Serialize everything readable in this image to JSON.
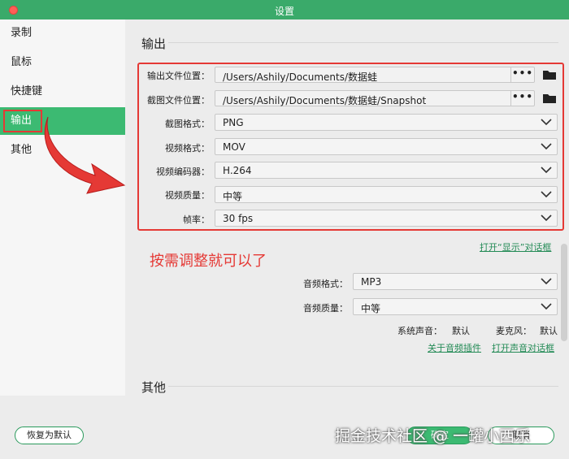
{
  "window": {
    "title": "设置"
  },
  "sidebar": {
    "items": [
      {
        "label": "录制"
      },
      {
        "label": "鼠标"
      },
      {
        "label": "快捷键"
      },
      {
        "label": "输出"
      },
      {
        "label": "其他"
      }
    ],
    "active_index": 3
  },
  "output": {
    "section_title": "输出",
    "output_location": {
      "label": "输出文件位置：",
      "value": "/Users/Ashily/Documents/数据蛙",
      "browse": "•••"
    },
    "screenshot_location": {
      "label": "截图文件位置：",
      "value": "/Users/Ashily/Documents/数据蛙/Snapshot",
      "browse": "•••"
    },
    "screenshot_format": {
      "label": "截图格式：",
      "value": "PNG"
    },
    "video_format": {
      "label": "视频格式：",
      "value": "MOV"
    },
    "video_encoder": {
      "label": "视频编码器：",
      "value": "H.264"
    },
    "video_quality": {
      "label": "视频质量：",
      "value": "中等"
    },
    "frame_rate": {
      "label": "帧率：",
      "value": "30 fps"
    },
    "open_display_dialog": "打开“显示”对话框",
    "annotation": "按需调整就可以了",
    "audio_format": {
      "label": "音频格式：",
      "value": "MP3"
    },
    "audio_quality": {
      "label": "音频质量：",
      "value": "中等"
    },
    "system_sound": {
      "label": "系统声音：",
      "value": "默认"
    },
    "microphone": {
      "label": "麦克风：",
      "value": "默认"
    },
    "about_audio_plugin": "关于音频插件",
    "open_sound_dialog": "打开声音对话框"
  },
  "other": {
    "section_title": "其他"
  },
  "footer": {
    "reset_label": "恢复为默认",
    "ok_label": "确定",
    "cancel_label": "取消"
  },
  "watermark": "掘金技术社区 @ 一罐小西乐",
  "colors": {
    "accent": "#3cba72",
    "titlebar": "#3aaa6a",
    "annotation_red": "#e53935",
    "link": "#228a55"
  }
}
